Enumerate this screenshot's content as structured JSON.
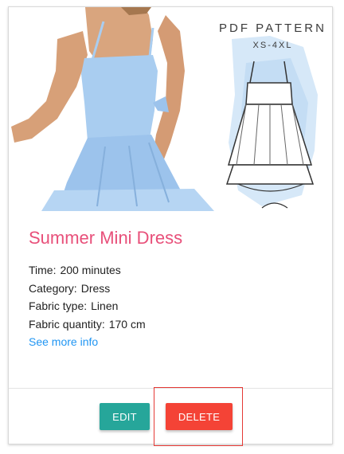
{
  "card": {
    "image": {
      "pattern_title": "PDF PATTERN",
      "pattern_sizes": "XS-4XL"
    },
    "title": "Summer Mini Dress",
    "details": [
      {
        "label": "Time:",
        "value": "200 minutes"
      },
      {
        "label": "Category:",
        "value": "Dress"
      },
      {
        "label": "Fabric type:",
        "value": "Linen"
      },
      {
        "label": "Fabric quantity:",
        "value": "170 cm"
      }
    ],
    "more_link": "See more info",
    "actions": {
      "edit_label": "EDIT",
      "delete_label": "DELETE"
    }
  },
  "colors": {
    "title": "#e8507a",
    "link": "#2196f3",
    "edit_button": "#26a69a",
    "delete_button": "#f44336",
    "highlight_box": "#e53935",
    "dress": "#a9cdf0"
  }
}
